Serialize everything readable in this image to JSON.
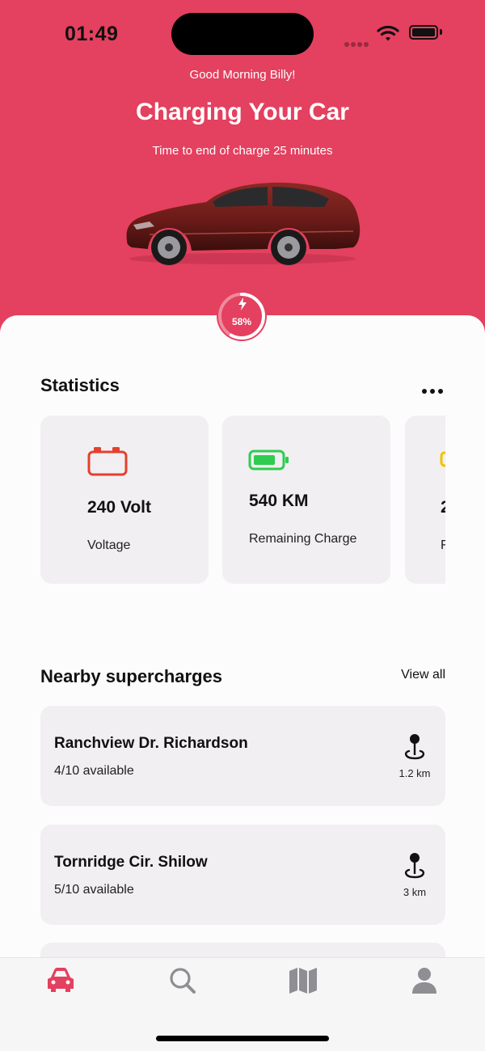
{
  "status_bar": {
    "time": "01:49"
  },
  "header": {
    "greeting": "Good Morning Billy!",
    "title": "Charging Your Car",
    "subtitle": "Time to end of charge 25 minutes",
    "charge_percent_label": "58%",
    "charge_progress": 0.58
  },
  "statistics": {
    "title": "Statistics",
    "cards": [
      {
        "icon": "battery-outline-icon",
        "value": "240 Volt",
        "label": "Voltage",
        "color": "#e4402f"
      },
      {
        "icon": "battery-charged-icon",
        "value": "540 KM",
        "label": "Remaining Charge",
        "color": "#2ecc50"
      },
      {
        "icon": "battery-icon",
        "value": "2",
        "label": "F",
        "color": "#f2c200"
      }
    ]
  },
  "nearby": {
    "title": "Nearby supercharges",
    "view_all": "View all",
    "stations": [
      {
        "name": "Ranchview Dr. Richardson",
        "availability": "4/10 available",
        "distance": "1.2 km"
      },
      {
        "name": "Tornridge Cir. Shilow",
        "availability": "5/10 available",
        "distance": "3 km"
      }
    ]
  },
  "tab_bar": {
    "tabs": [
      {
        "icon": "car-icon",
        "active": true
      },
      {
        "icon": "search-icon",
        "active": false
      },
      {
        "icon": "map-icon",
        "active": false
      },
      {
        "icon": "profile-icon",
        "active": false
      }
    ]
  },
  "colors": {
    "accent": "#e4405f",
    "card": "#f1eff1",
    "inactive_icon": "#8e8e93"
  }
}
